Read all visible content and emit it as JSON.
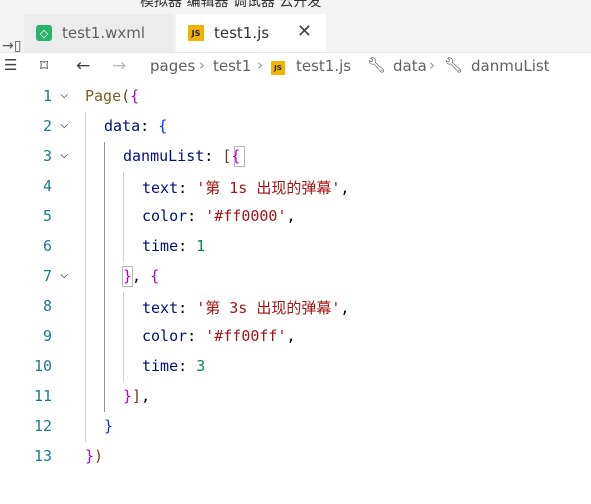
{
  "menu_strip": "模拟器  编辑器  调试器  云开发",
  "tabs": [
    {
      "label": "test1.wxml",
      "icon": "wxml-file-icon"
    },
    {
      "label": "test1.js",
      "icon": "js-file-icon"
    }
  ],
  "breadcrumb": {
    "items": [
      "pages",
      "test1",
      "test1.js",
      "data",
      "danmuList"
    ]
  },
  "code": {
    "lines": [
      {
        "num": "1",
        "text": "Page({"
      },
      {
        "num": "2",
        "text": "data: {"
      },
      {
        "num": "3",
        "text": "danmuList: [{"
      },
      {
        "num": "4",
        "text": "text: '第 1s 出现的弹幕',"
      },
      {
        "num": "5",
        "text": "color: '#ff0000',"
      },
      {
        "num": "6",
        "text": "time: 1"
      },
      {
        "num": "7",
        "text": "}, {"
      },
      {
        "num": "8",
        "text": "text: '第 3s 出现的弹幕',"
      },
      {
        "num": "9",
        "text": "color: '#ff00ff',"
      },
      {
        "num": "10",
        "text": "time: 3"
      },
      {
        "num": "11",
        "text": "}],"
      },
      {
        "num": "12",
        "text": "}"
      },
      {
        "num": "13",
        "text": "})"
      }
    ],
    "tokens": {
      "page": "Page",
      "data": "data",
      "danmuList": "danmuList",
      "text": "text",
      "color": "color",
      "time": "time",
      "str1": "'第 1s 出现的弹幕'",
      "str2": "'#ff0000'",
      "str3": "'第 3s 出现的弹幕'",
      "str4": "'#ff00ff'",
      "num1": "1",
      "num2": "3"
    }
  }
}
